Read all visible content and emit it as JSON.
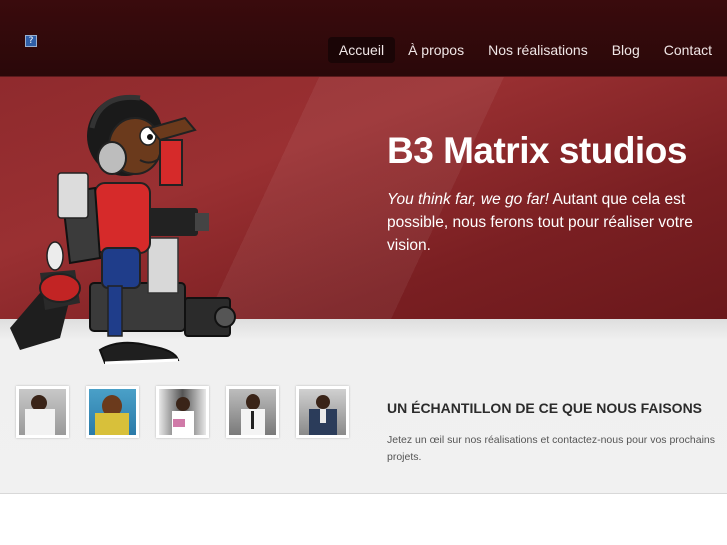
{
  "logo": {
    "icon": "broken-image-icon",
    "glyph": "?"
  },
  "nav": {
    "items": [
      {
        "label": "Accueil",
        "active": true
      },
      {
        "label": "À propos",
        "active": false
      },
      {
        "label": "Nos réalisations",
        "active": false
      },
      {
        "label": "Blog",
        "active": false
      },
      {
        "label": "Contact",
        "active": false
      }
    ]
  },
  "hero": {
    "title": "B3 Matrix studios",
    "tagline": "You think far, we go far!",
    "text": " Autant que cela est possible, nous ferons tout pour réaliser votre vision."
  },
  "section": {
    "title": "UN ÉCHANTILLON DE CE QUE NOUS FAISONS",
    "text": "Jetez un œil sur nos réalisations et contactez-nous pour vos prochains projets."
  },
  "colors": {
    "header_bg": "#2a0809",
    "hero_bg": "#8f2a2d",
    "band_bg": "#f1f1f1",
    "nav_active_bg": "#1a0506"
  }
}
